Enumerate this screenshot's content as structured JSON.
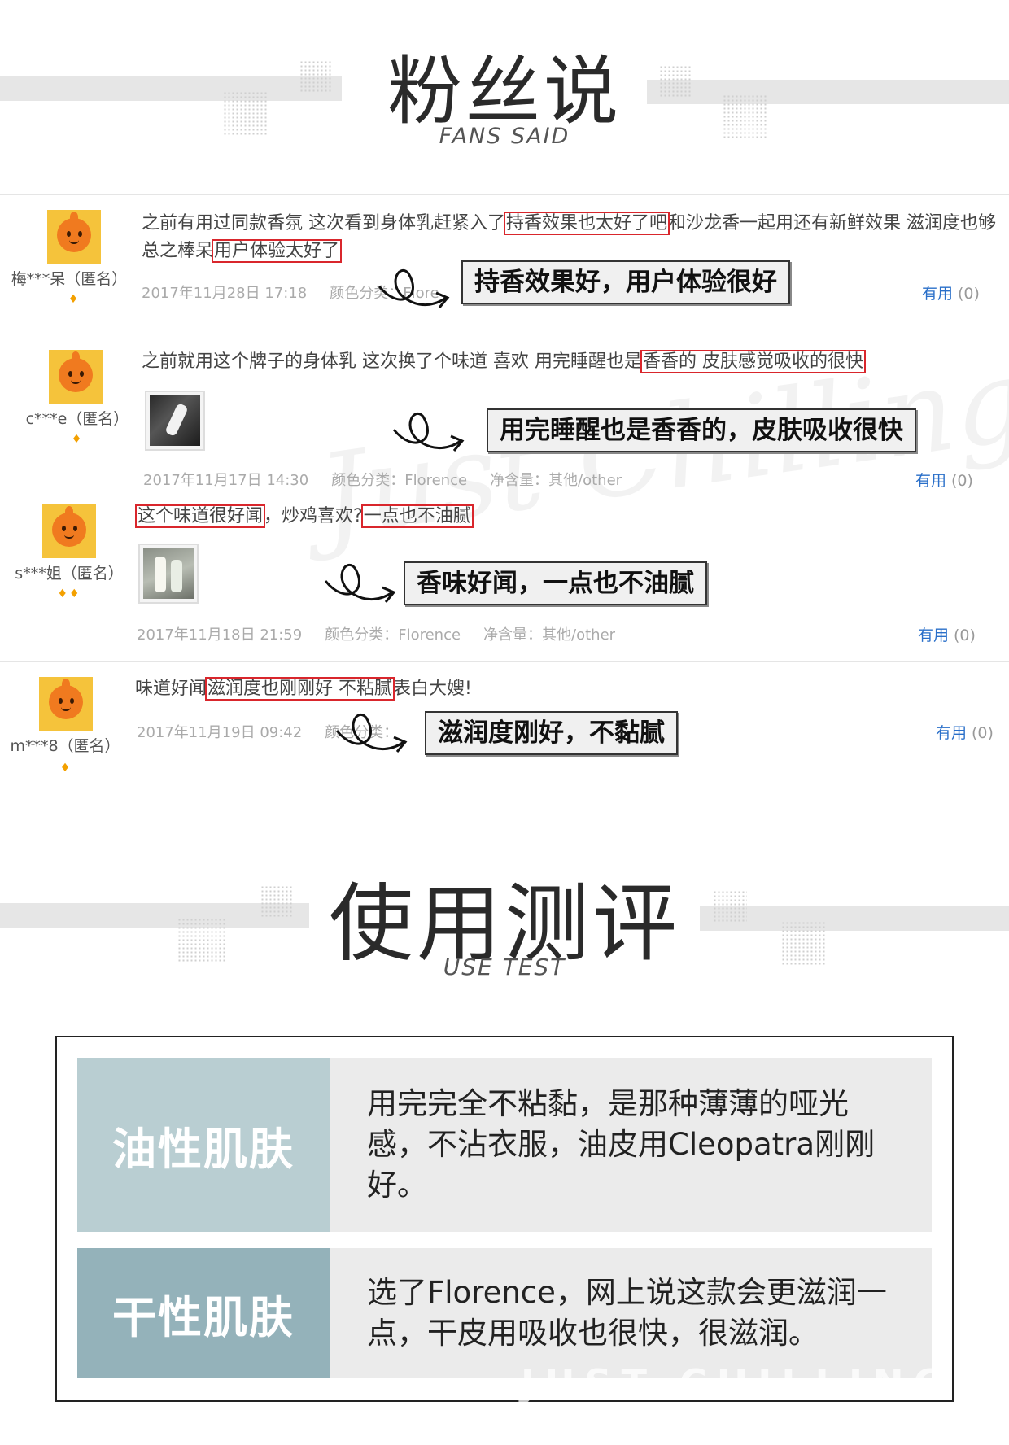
{
  "fans_section": {
    "title": "粉丝说",
    "subtitle": "FANS SAID"
  },
  "watermark": "Just Chilling",
  "reviews": [
    {
      "user": "梅***呆（匿名）",
      "gems": "♦",
      "text": {
        "p1": "之前有用过同款香氛 这次看到身体乳赶紧入了",
        "h1": "持香效果也太好了吧",
        "p2": "和沙龙香一起用还有新鲜效果 滋润度也够 总之棒呆",
        "h2": "用户体验太好了"
      },
      "date": "2017年11月28日 17:18",
      "spec": "颜色分类：Flore",
      "callout": "持香效果好，用户体验很好",
      "useful_label": "有用",
      "useful_count": "(0)"
    },
    {
      "user": "c***e（匿名）",
      "gems": "♦",
      "text": {
        "p1": "之前就用这个牌子的身体乳 这次换了个味道 喜欢 用完睡醒也是",
        "h1": "香香的 皮肤感觉吸收的很快"
      },
      "date": "2017年11月17日 14:30",
      "spec": "颜色分类：Florence",
      "volume": "净含量：其他/other",
      "callout": "用完睡醒也是香香的，皮肤吸收很快",
      "useful_label": "有用",
      "useful_count": "(0)"
    },
    {
      "user": "s***姐（匿名）",
      "gems": "♦♦",
      "text": {
        "h1": "这个味道很好闻",
        "p1": "，炒鸡喜欢?",
        "h2": "一点也不油腻"
      },
      "date": "2017年11月18日 21:59",
      "spec": "颜色分类：Florence",
      "volume": "净含量：其他/other",
      "callout": "香味好闻，一点也不油腻",
      "useful_label": "有用",
      "useful_count": "(0)"
    },
    {
      "user": "m***8（匿名）",
      "gems": "♦",
      "text": {
        "p1": "味道好闻",
        "h1": "滋润度也刚刚好 不粘腻",
        "p2": "表白大嫂!"
      },
      "date": "2017年11月19日 09:42",
      "spec": "颜色分类：",
      "callout": "滋润度刚好，不黏腻",
      "useful_label": "有用",
      "useful_count": "(0)"
    }
  ],
  "use_section": {
    "title": "使用测评",
    "subtitle": "USE TEST"
  },
  "use_test": [
    {
      "label": "油性肌肤",
      "text": "用完完全不粘黏，是那种薄薄的哑光感，不沾衣服，油皮用Cleopatra刚刚好。",
      "color": "#b9ced2"
    },
    {
      "label": "干性肌肤",
      "text": "选了Florence，网上说这款会更滋润一点，干皮用吸收也很快，很滋润。",
      "color": "#94b2ba"
    }
  ],
  "table_watermark": "JUST CHILLING",
  "colors": {
    "highlight": "#d9262c",
    "useful": "#2a6fc9",
    "band": "#e6e6e6"
  }
}
